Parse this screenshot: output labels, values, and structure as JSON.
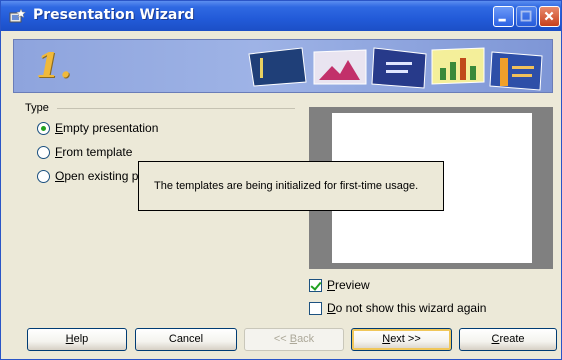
{
  "window": {
    "title": "Presentation Wizard"
  },
  "banner": {
    "step_number": "1."
  },
  "type_group": {
    "label": "Type",
    "options": [
      {
        "label_accel": "E",
        "label_rest": "mpty presentation",
        "selected": true
      },
      {
        "label_accel": "F",
        "label_rest": "rom template",
        "selected": false
      },
      {
        "label_accel": "O",
        "label_rest": "pen existing pr",
        "selected": false
      }
    ]
  },
  "tooltip": {
    "text": "The templates are being initialized for first-time usage."
  },
  "preview_checkbox": {
    "accel": "P",
    "rest": "review",
    "checked": true
  },
  "no_show_checkbox": {
    "accel": "D",
    "rest": "o not show this wizard again",
    "checked": false
  },
  "buttons": {
    "help": {
      "accel": "H",
      "rest": "elp"
    },
    "cancel": {
      "label": "Cancel"
    },
    "back": {
      "prefix": "<< ",
      "accel": "B",
      "rest": "ack",
      "enabled": false
    },
    "next": {
      "accel": "N",
      "rest": "ext >>"
    },
    "create": {
      "accel": "C",
      "rest": "reate"
    }
  },
  "colors": {
    "titlebar": "#225ad8",
    "dialog_bg": "#ece9d8",
    "accent_green": "#21a121",
    "step_number": "#f0b93a"
  }
}
